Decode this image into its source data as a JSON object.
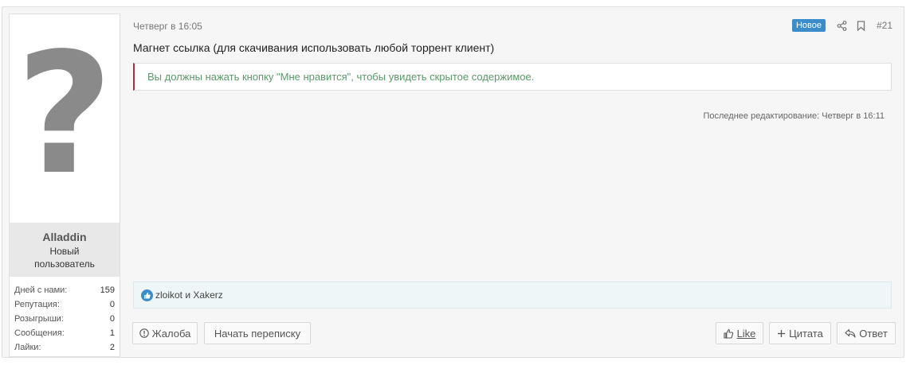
{
  "user": {
    "avatar_glyph": "?",
    "name": "Alladdin",
    "title": "Новый пользователь",
    "stats": [
      {
        "label": "Дней с нами:",
        "value": "159"
      },
      {
        "label": "Репутация:",
        "value": "0"
      },
      {
        "label": "Розыгрыши:",
        "value": "0"
      },
      {
        "label": "Сообщения:",
        "value": "1"
      },
      {
        "label": "Лайки:",
        "value": "2"
      }
    ]
  },
  "post": {
    "date": "Четверг в 16:05",
    "badge": "Новое",
    "number": "#21",
    "title": "Магнет ссылка (для скачивания использовать любой торрент клиент)",
    "hidden_notice": "Вы должны нажать кнопку \"Мне нравится\", чтобы увидеть скрытое содержимое.",
    "edit_note": "Последнее редактирование: Четверг в 16:11",
    "likes_text": "zloikot и Xakerz"
  },
  "actions": {
    "report": "Жалоба",
    "start_conversation": "Начать переписку",
    "like": "Like",
    "quote": "Цитата",
    "reply": "Ответ"
  },
  "icons": {
    "share": "share-icon",
    "bookmark": "bookmark-icon",
    "like": "thumbs-up-icon",
    "report": "alert-circle-icon",
    "quote": "plus-icon",
    "reply": "reply-icon"
  },
  "colors": {
    "badge": "#3a8ccb",
    "hidden_border": "#b03040",
    "hidden_text": "#5a9a6a",
    "likes_bg": "#eef6f8"
  }
}
